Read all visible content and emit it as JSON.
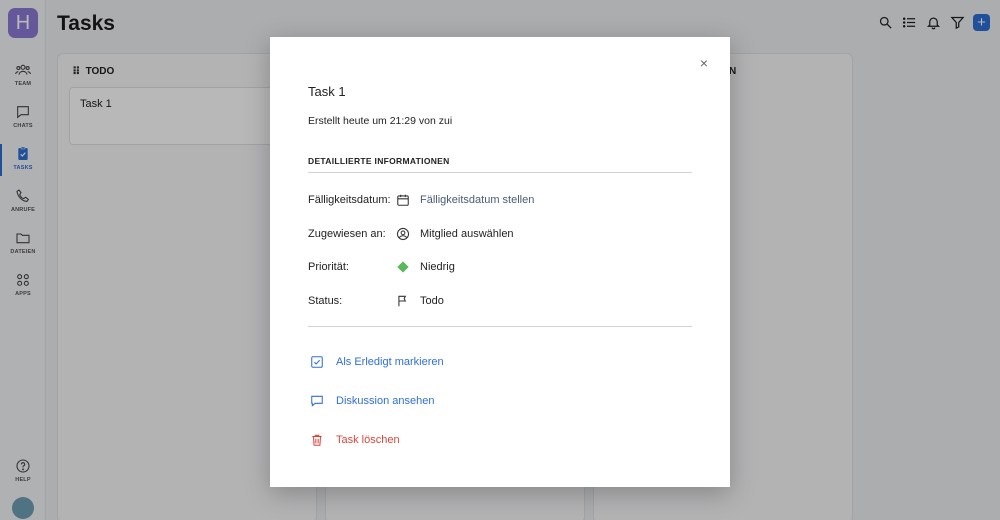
{
  "app": {
    "logo_letter": "H",
    "page_title": "Tasks"
  },
  "sidebar": {
    "items": [
      {
        "label": "TEAM",
        "icon": "team-icon"
      },
      {
        "label": "CHATS",
        "icon": "chat-icon"
      },
      {
        "label": "TASKS",
        "icon": "tasks-icon",
        "active": true
      },
      {
        "label": "ANRUFE",
        "icon": "phone-icon"
      },
      {
        "label": "DATEIEN",
        "icon": "folder-icon"
      },
      {
        "label": "APPS",
        "icon": "apps-icon"
      }
    ],
    "help_label": "HELP"
  },
  "board": {
    "columns": [
      {
        "title": "TODO",
        "add": "+",
        "tasks": [
          "Task 1"
        ]
      },
      {
        "title": "",
        "tasks": []
      },
      {
        "title_fragment": "N",
        "tasks": []
      }
    ]
  },
  "modal": {
    "close": "×",
    "title": "Task 1",
    "created": "Erstellt heute um 21:29 von zui",
    "section_title": "DETAILLIERTE INFORMATIONEN",
    "fields": {
      "due_label": "Fälligkeitsdatum:",
      "due_value": "Fälligkeitsdatum stellen",
      "assigned_label": "Zugewiesen an:",
      "assigned_value": "Mitglied auswählen",
      "priority_label": "Priorität:",
      "priority_value": "Niedrig",
      "status_label": "Status:",
      "status_value": "Todo"
    },
    "actions": {
      "mark_done": "Als Erledigt markieren",
      "discussion": "Diskussion ansehen",
      "delete": "Task löschen"
    }
  },
  "colors": {
    "accent": "#2f6fd6",
    "danger": "#d9453b",
    "priority_low": "#5cb85c",
    "logo": "#8c7bd6"
  }
}
